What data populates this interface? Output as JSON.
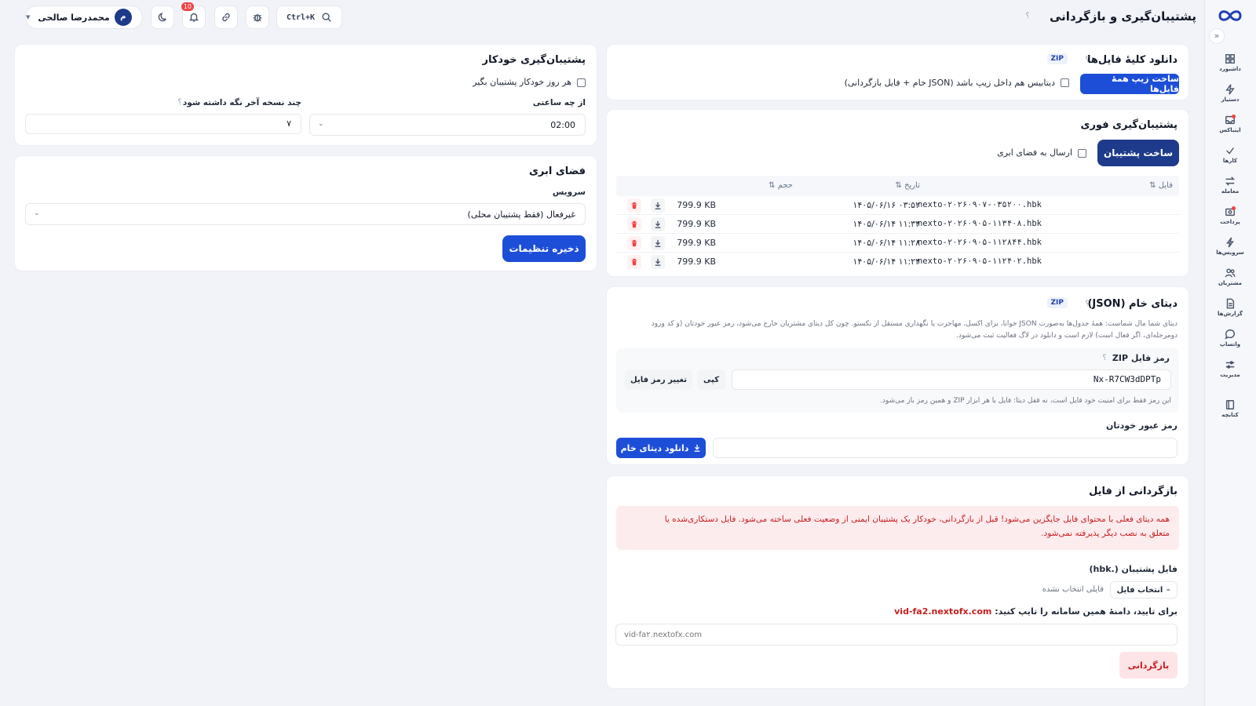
{
  "header": {
    "page_title": "پشتیبان‌گیری و بازگردانی",
    "help": "؟",
    "search_shortcut": "Ctrl+K",
    "notifications_count": "10",
    "user_initial": "م",
    "user_name": "محمدرضا صالحی"
  },
  "sidebar": {
    "collapse": "«",
    "items": [
      {
        "label": "داشبورد",
        "icon": "grid-icon"
      },
      {
        "label": "دستیار",
        "icon": "bolt-icon"
      },
      {
        "label": "اینباکس",
        "icon": "inbox-icon"
      },
      {
        "label": "کارها",
        "icon": "check-icon"
      },
      {
        "label": "معامله",
        "icon": "swap-icon"
      },
      {
        "label": "پرداخت",
        "icon": "card-icon"
      },
      {
        "label": "سرویس‌ها",
        "icon": "lightning-icon"
      },
      {
        "label": "مشتریان",
        "icon": "users-icon"
      },
      {
        "label": "گزارش‌ها",
        "icon": "file-icon"
      },
      {
        "label": "واتساپ",
        "icon": "chat-icon"
      },
      {
        "label": "مدیریت",
        "icon": "sliders-icon"
      },
      {
        "label": "کتابچه",
        "icon": "book-icon"
      }
    ]
  },
  "download_all": {
    "title": "دانلود کلیهٔ فایل‌ها",
    "tag": "ZIP",
    "button": "ساخت زیپ همهٔ فایل‌ها",
    "checkbox_label": "دیتابیس هم داخل زیپ باشد (JSON خام + فایل بازگردانی)"
  },
  "instant_backup": {
    "title": "پشتیبان‌گیری فوری",
    "button": "ساخت پشتیبان",
    "cloud_checkbox": "ارسال به فضای ابری",
    "columns": {
      "file": "فایل ⇅",
      "date": "تاریخ ⇅",
      "size": "حجم ⇅"
    },
    "rows": [
      {
        "file": "nexto-۲۰۲۶۰۹۰۷-۰۳۵۲۰۰.hbk",
        "date": "۱۴۰۵/۰۶/۱۶ ۰۳:۵۲",
        "size": "799.9 KB"
      },
      {
        "file": "nexto-۲۰۲۶۰۹۰۵-۱۱۳۴۰۸.hbk",
        "date": "۱۴۰۵/۰۶/۱۴ ۱۱:۳۴",
        "size": "799.9 KB"
      },
      {
        "file": "nexto-۲۰۲۶۰۹۰۵-۱۱۲۸۴۴.hbk",
        "date": "۱۴۰۵/۰۶/۱۴ ۱۱:۲۸",
        "size": "799.9 KB"
      },
      {
        "file": "nexto-۲۰۲۶۰۹۰۵-۱۱۲۴۰۲.hbk",
        "date": "۱۴۰۵/۰۶/۱۴ ۱۱:۲۴",
        "size": "799.9 KB"
      }
    ]
  },
  "raw_data": {
    "title": "دیتای خام (JSON)",
    "tag": "ZIP",
    "description_1": "دیتای شما مال شماست: همهٔ جدول‌ها به‌صورت JSON خوانا، برای اکسل، مهاجرت یا نگهداری مستقل از نکستو. چون کل دیتای مشتریان خارج می‌شود، رمز عبور خودتان (و کد ورود",
    "description_2": "دومرحله‌ای، اگر فعال است) لازم است و دانلود در لاگ فعالیت ثبت می‌شود.",
    "zip_password_label": "رمز فایل ZIP",
    "zip_password_value": "Nx-R7CW3dDPTp",
    "copy_button": "کپی",
    "change_button": "تغییر رمز فایل",
    "zip_note": "این رمز فقط برای امنیت خود فایل است، نه قفل دیتا: فایل با هر ابزار ZIP و همین رمز باز می‌شود.",
    "own_password_label": "رمز عبور خودتان",
    "download_button": "دانلود دیتای خام"
  },
  "restore": {
    "title": "بازگردانی از فایل",
    "warning_1": "همه دیتای فعلی با محتوای فایل جایگزین می‌شود! قبل از بازگردانی، خودکار یک پشتیبان ایمنی از وضعیت فعلی ساخته می‌شود. فایل دستکاری‌شده یا",
    "warning_2": "متعلق به نصب دیگر پذیرفته نمی‌شود.",
    "file_label": "فایل پشتیبان (.hbk)",
    "choose_file": "انتخاب فایل",
    "no_file": "فایلی انتخاب نشده",
    "confirm_prefix": "برای تایید، دامنهٔ همین سامانه را تایپ کنید:",
    "confirm_domain": "vid-fa2.nextofx.com",
    "domain_placeholder": "vid-fa۲.nextofx.com",
    "restore_button": "بازگردانی"
  },
  "auto_backup": {
    "title": "پشتیبان‌گیری خودکار",
    "daily_checkbox": "هر روز خودکار پشتیبان بگیر",
    "hour_label": "از چه ساعتی",
    "hour_value": "02:00",
    "keep_label": "چند نسخه آخر نگه داشته شود",
    "keep_value": "۷"
  },
  "cloud": {
    "title": "فضای ابری",
    "service_label": "سرویس",
    "service_value": "غیرفعال (فقط پشتیبان محلی)",
    "save_button": "ذخیره تنظیمات"
  },
  "colors": {
    "primary": "#1d4ed8",
    "dark_primary": "#1e3a8a",
    "danger": "#c81e1e",
    "danger_bg": "#fdecee"
  }
}
